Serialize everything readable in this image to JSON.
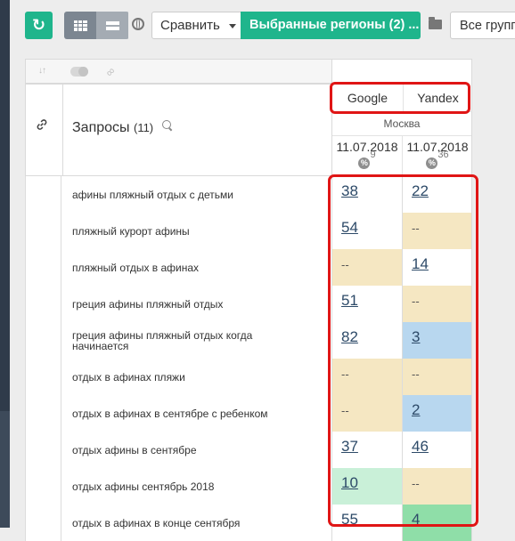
{
  "toolbar": {
    "compare_label": "Сравнить",
    "regions_label": "Выбранные регионы (2) ...",
    "groups_label": "Все групп"
  },
  "table": {
    "header": {
      "title": "Запросы",
      "count": "(11)",
      "engines": [
        "Google",
        "Yandex"
      ],
      "city": "Москва",
      "date_google": "11.07.2018",
      "date_yandex": "11.07.2018",
      "pct_google": "9",
      "pct_yandex": "36",
      "pct_symbol": "%"
    },
    "rows": [
      {
        "query": "афины пляжный отдых с детьми",
        "google": "38",
        "yandex": "22"
      },
      {
        "query": "пляжный курорт афины",
        "google": "54",
        "yandex": "--"
      },
      {
        "query": "пляжный отдых в афинах",
        "google": "--",
        "yandex": "14"
      },
      {
        "query": "греция афины пляжный отдых",
        "google": "51",
        "yandex": "--"
      },
      {
        "query": "греция афины пляжный отдых когда начинается",
        "google": "82",
        "yandex": "3"
      },
      {
        "query": "отдых в афинах пляжи",
        "google": "--",
        "yandex": "--"
      },
      {
        "query": "отдых в афинах в сентябре с ребенком",
        "google": "--",
        "yandex": "2"
      },
      {
        "query": "отдых афины в сентябре",
        "google": "37",
        "yandex": "46"
      },
      {
        "query": "отдых афины сентябрь 2018",
        "google": "10",
        "yandex": "--"
      },
      {
        "query": "отдых в афинах в конце сентября",
        "google": "55",
        "yandex": "4"
      }
    ]
  },
  "colors": {
    "accent": "#1fb58c",
    "highlight": "#e01515",
    "cell_white": "#ffffff",
    "cell_beige": "#f5e7c2",
    "cell_blue": "#b8d7ef",
    "cell_lightgreen": "#c9f0d8",
    "cell_green": "#8fdea8"
  },
  "cell_colors": [
    [
      "white",
      "white"
    ],
    [
      "white",
      "beige"
    ],
    [
      "beige",
      "white"
    ],
    [
      "white",
      "beige"
    ],
    [
      "white",
      "blue"
    ],
    [
      "beige",
      "beige"
    ],
    [
      "beige",
      "blue"
    ],
    [
      "white",
      "white"
    ],
    [
      "lightgreen",
      "beige"
    ],
    [
      "white",
      "green"
    ]
  ]
}
